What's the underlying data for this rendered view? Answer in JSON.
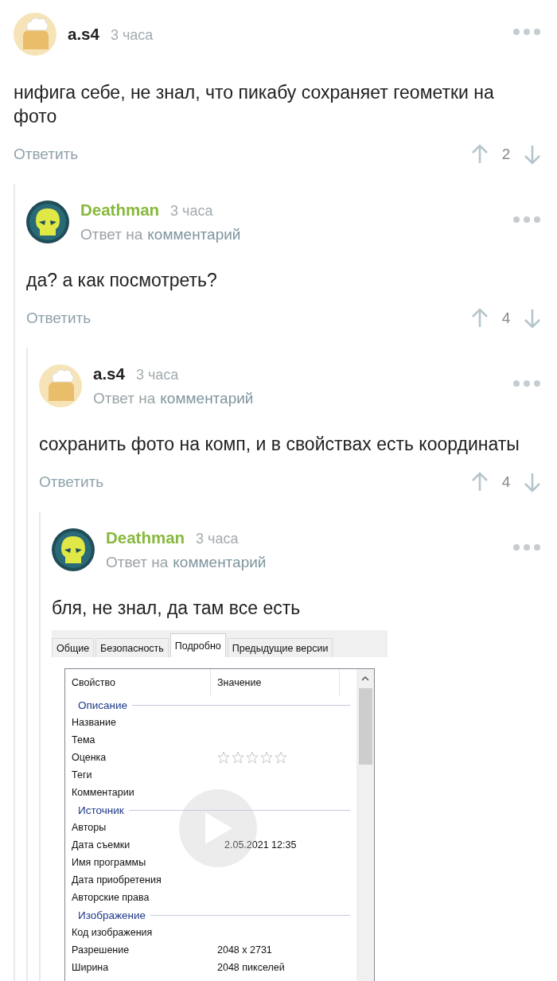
{
  "comments": [
    {
      "author": "a.s4",
      "color": "#222222",
      "avatar": {
        "kind": "chef"
      },
      "time": "3 часа",
      "text": "нифига себе, не знал, что пикабу сохраняет геометки на фото",
      "reply": "Ответить",
      "score": "2",
      "children": [
        {
          "author": "Deathman",
          "color": "#86b93c",
          "avatar": {
            "kind": "skull"
          },
          "time": "3 часа",
          "reply_to": {
            "prefix": "Ответ на",
            "link": "комментарий"
          },
          "text": "да? а как посмотреть?",
          "reply": "Ответить",
          "score": "4",
          "children": [
            {
              "author": "a.s4",
              "color": "#222222",
              "avatar": {
                "kind": "chef"
              },
              "time": "3 часа",
              "reply_to": {
                "prefix": "Ответ на",
                "link": "комментарий"
              },
              "text": "сохранить фото на комп, и в свойствах есть координаты",
              "reply": "Ответить",
              "score": "4",
              "children": [
                {
                  "author": "Deathman",
                  "color": "#86b93c",
                  "avatar": {
                    "kind": "skull"
                  },
                  "time": "3 часа",
                  "reply_to": {
                    "prefix": "Ответ на",
                    "link": "комментарий"
                  },
                  "text": "бля, не знал, да там все есть",
                  "media": {
                    "kind": "properties_screenshot",
                    "tabs": [
                      {
                        "label": "Общие",
                        "selected": false
                      },
                      {
                        "label": "Безопасность",
                        "selected": false
                      },
                      {
                        "label": "Подробно",
                        "selected": true
                      },
                      {
                        "label": "Предыдущие версии",
                        "selected": false
                      }
                    ],
                    "columns": [
                      "Свойство",
                      "Значение"
                    ],
                    "sections": [
                      {
                        "title": "Описание",
                        "rows": [
                          {
                            "property": "Название"
                          },
                          {
                            "property": "Тема"
                          },
                          {
                            "property": "Оценка",
                            "stars": 0
                          },
                          {
                            "property": "Теги"
                          },
                          {
                            "property": "Комментарии"
                          }
                        ]
                      },
                      {
                        "title": "Источник",
                        "rows": [
                          {
                            "property": "Авторы"
                          },
                          {
                            "property": "Дата съемки",
                            "value": "2.05.2021 12:35"
                          },
                          {
                            "property": "Имя программы"
                          },
                          {
                            "property": "Дата приобретения"
                          },
                          {
                            "property": "Авторские права"
                          }
                        ]
                      },
                      {
                        "title": "Изображение",
                        "rows": [
                          {
                            "property": "Код изображения"
                          },
                          {
                            "property": "Разрешение",
                            "value": "2048 x 2731"
                          },
                          {
                            "property": "Ширина",
                            "value": "2048 пикселей"
                          }
                        ]
                      }
                    ]
                  }
                }
              ]
            }
          ]
        }
      ]
    }
  ]
}
